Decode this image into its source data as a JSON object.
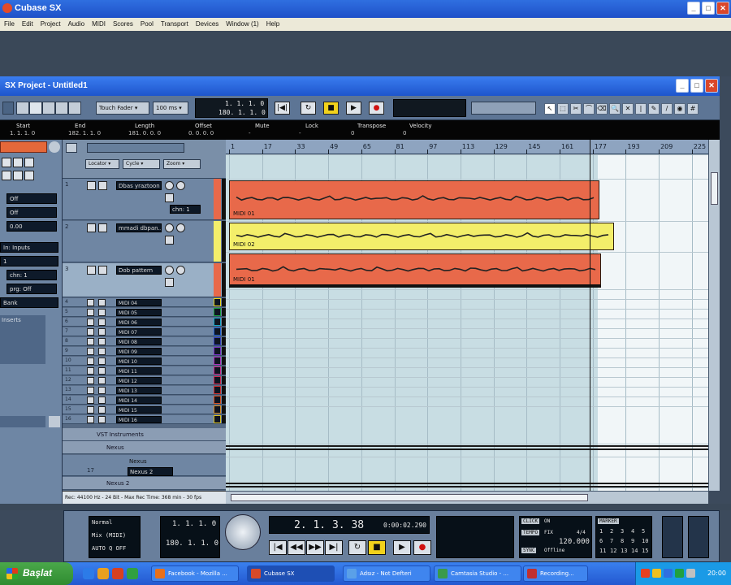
{
  "app": {
    "title": "Cubase SX"
  },
  "menu": [
    "File",
    "Edit",
    "Project",
    "Audio",
    "MIDI",
    "Scores",
    "Pool",
    "Transport",
    "Devices",
    "Window (1)",
    "Help"
  ],
  "project": {
    "title": "SX Project - Untitled1",
    "toolbar": {
      "mode": "Touch Fader",
      "latency": "100 ms",
      "pos_top": "1. 1. 1. 0",
      "pos_bottom": "180. 1. 1. 0"
    },
    "infoline": {
      "headers": [
        "Start",
        "End",
        "Length",
        "Offset",
        "Mute",
        "Lock",
        "Transpose",
        "Velocity"
      ],
      "values": [
        "1. 1. 1. 0",
        "182. 1. 1. 0",
        "181. 0. 0. 0",
        "0. 0. 0. 0",
        "-",
        "-",
        "0",
        "0"
      ]
    }
  },
  "inspector": {
    "boxes": [
      "Off",
      "Off",
      "0.00",
      "In: Inputs",
      "1",
      "chn: 1",
      "prg: Off",
      "Bank"
    ],
    "label": "Inserts"
  },
  "tracklist": {
    "header": {
      "locator": "Locator",
      "cycle": "Cycle",
      "zoom": "Zoom"
    },
    "tracks": [
      {
        "num": "1",
        "name": "Dbas yraztoon",
        "extra": "chn: 1"
      },
      {
        "num": "2",
        "name": "mmadi dbpan..."
      },
      {
        "num": "3",
        "name": "Dob pattern"
      },
      {
        "num": "4",
        "name": "MIDI 04",
        "color": "#e8d41a"
      },
      {
        "num": "5",
        "name": "MIDI 05",
        "color": "#17a23e"
      },
      {
        "num": "6",
        "name": "MIDI 06",
        "color": "#14a8c8"
      },
      {
        "num": "7",
        "name": "MIDI 07",
        "color": "#1f62d6"
      },
      {
        "num": "8",
        "name": "MIDI 08",
        "color": "#3540c0"
      },
      {
        "num": "9",
        "name": "MIDI 09",
        "color": "#7a30c8"
      },
      {
        "num": "10",
        "name": "MIDI 10",
        "color": "#b030c0"
      },
      {
        "num": "11",
        "name": "MIDI 11",
        "color": "#d02890"
      },
      {
        "num": "12",
        "name": "MIDI 12",
        "color": "#d02850"
      },
      {
        "num": "13",
        "name": "MIDI 13",
        "color": "#d03030"
      },
      {
        "num": "14",
        "name": "MIDI 14",
        "color": "#d85020"
      },
      {
        "num": "15",
        "name": "MIDI 15",
        "color": "#d88a20"
      },
      {
        "num": "16",
        "name": "MIDI 16",
        "color": "#d8c020"
      }
    ],
    "vst_folder": "VST Instruments",
    "nexus_folder": "Nexus",
    "nexus_track": {
      "name": "Nexus",
      "num": "17",
      "sub": "Nexus 2"
    },
    "nexus2_folder": "Nexus 2",
    "nexus2_track": {
      "name": "Nexus 2"
    },
    "status": "Rec: 44100 Hz - 24 Bit - Max Rec Time: 368 min - 30 fps"
  },
  "ruler": {
    "ticks": [
      "1",
      "17",
      "33",
      "49",
      "65",
      "81",
      "97",
      "113",
      "129",
      "145",
      "161",
      "177",
      "193",
      "209",
      "225"
    ]
  },
  "parts": [
    {
      "label": "MIDI 01",
      "fill": "#e8694a"
    },
    {
      "label": "MIDI 02",
      "fill": "#f3ee6a"
    },
    {
      "label": "MIDI 01",
      "fill": "#e8694a"
    }
  ],
  "transport": {
    "mode": "Normal",
    "mix_mode": "Mix (MIDI)",
    "auto_q": "AUTO Q",
    "auto_q_state": "OFF",
    "left_top": "1. 1. 1. 0",
    "left_bottom": "180. 1. 1. 0",
    "position": "2. 1. 3. 38",
    "time": "0:00:02.290",
    "click": "CLICK",
    "click_state": "ON",
    "tempo_label": "TEMPO",
    "tempo_state": "FIX",
    "signature": "4/4",
    "tempo": "120.000",
    "sync": "SYNC",
    "sync_state": "Offline",
    "marker": "MARKER",
    "keypad": [
      "1",
      "2",
      "3",
      "4",
      "5",
      "6",
      "7",
      "8",
      "9",
      "10",
      "11",
      "12",
      "13",
      "14",
      "15"
    ]
  },
  "taskbar": {
    "start": "Başlat",
    "tasks": [
      "Facebook - Mozilla ...",
      "Cubase SX",
      "Adsız - Not Defteri",
      "Camtasia Studio - ...",
      "Recording..."
    ],
    "clock": "20:00"
  }
}
